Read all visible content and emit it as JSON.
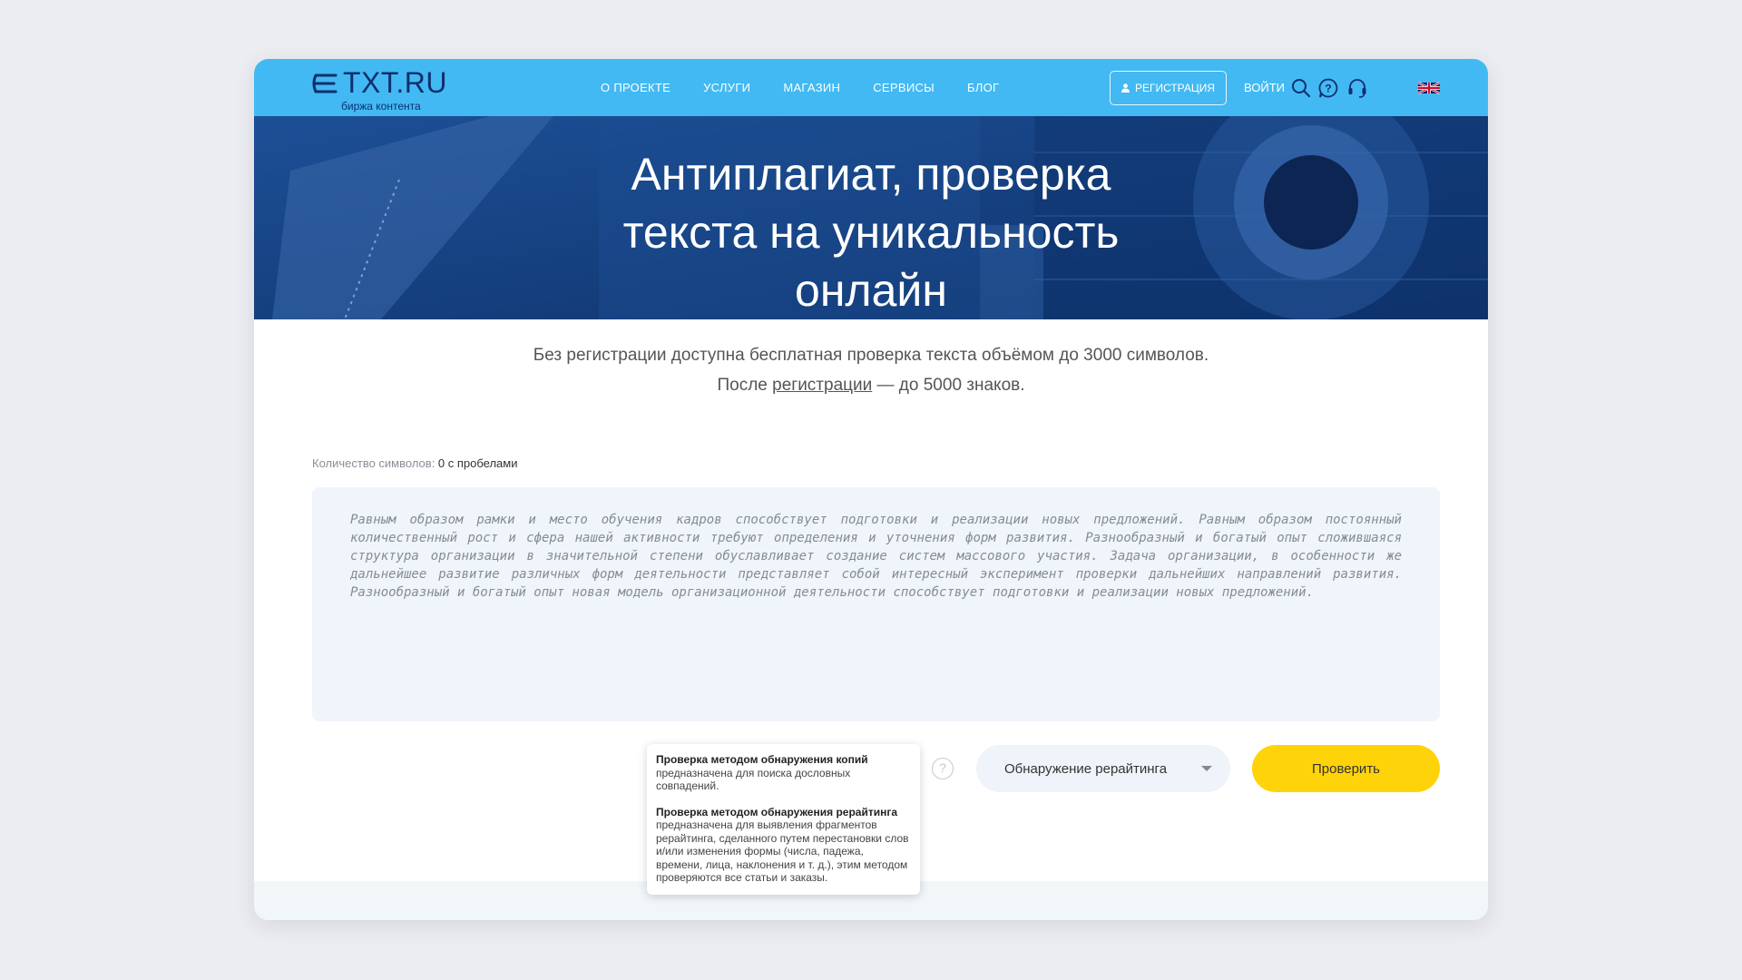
{
  "header": {
    "logo_text": "TXT.RU",
    "logo_sub": "биржа контента",
    "nav": [
      "О ПРОЕКТЕ",
      "УСЛУГИ",
      "МАГАЗИН",
      "СЕРВИСЫ",
      "БЛОГ"
    ],
    "register_label": "РЕГИСТРАЦИЯ",
    "login_label": "ВОЙТИ",
    "icons": [
      "search-icon",
      "help-bubble-icon",
      "support-headset-icon",
      "uk-flag-icon"
    ]
  },
  "hero": {
    "title_line1": "Антиплагиат, проверка",
    "title_line2": "текста на уникальность",
    "title_line3": "онлайн"
  },
  "intro": {
    "line1": "Без регистрации доступна бесплатная проверка текста объёмом до 3000 символов.",
    "line2_before": "После ",
    "line2_link": "регистрации",
    "line2_after": " — до 5000 знаков."
  },
  "counter": {
    "label": "Количество символов: ",
    "value": "0 с пробелами"
  },
  "editor": {
    "placeholder": "Равным образом рамки и место обучения кадров способствует подготовки и реализации новых предложений. Равным образом постоянный количественный рост и сфера нашей активности требуют определения и уточнения форм развития. Разнообразный и богатый опыт сложившаяся структура организации в значительной степени обуславливает создание систем массового участия. Задача организации, в особенности же дальнейшее развитие различных форм деятельности представляет собой интересный эксперимент проверки дальнейших направлений развития. Разнообразный и богатый опыт новая модель организационной деятельности способствует подготовки и реализации новых предложений."
  },
  "tooltip": {
    "title1": "Проверка методом обнаружения копий",
    "text1": "предназначена для поиска дословных совпадений.",
    "title2": "Проверка методом обнаружения рерайтинга",
    "text2": "предназначена для выявления фрагментов рерайтинга, сделанного путем перестановки слов и/или изменения формы (числа, падежа, времени, лица, наклонения и т. д.), этим методом проверяются все статьи и заказы."
  },
  "controls": {
    "help_glyph": "?",
    "method_selected": "Обнаружение рерайтинга",
    "check_label": "Проверить"
  },
  "colors": {
    "header_bg": "#42b9f2",
    "hero_bg": "#123a7a",
    "button_yellow": "#ffd30a",
    "logo_navy": "#0f2f6e"
  }
}
